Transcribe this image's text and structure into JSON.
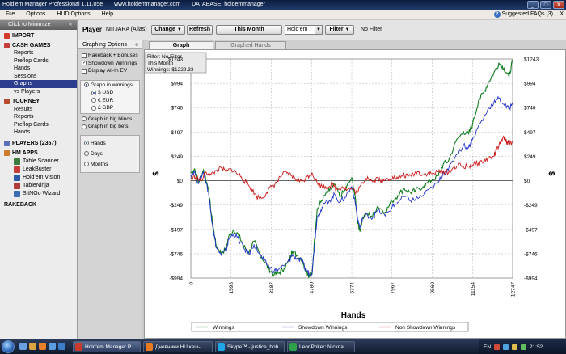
{
  "window": {
    "title": "Hold'em Manager Professional 1.11.05e",
    "site": "www.holdemmanager.com",
    "database": "DATABASE: holdemmanager",
    "controls": [
      "_",
      "□",
      "X"
    ]
  },
  "menu": {
    "items": [
      "File",
      "Options",
      "HUD Options",
      "Help"
    ],
    "faq": "Suggested FAQs (3)",
    "close": "X"
  },
  "nav": {
    "minimize": "Click to Minimize",
    "import": "IMPORT",
    "cash_games": "CASH GAMES",
    "cash_items": [
      "Reports",
      "Preflop Cards",
      "Hands",
      "Sessions",
      "Graphs",
      "vs Players"
    ],
    "tourney": "TOURNEY",
    "tourney_items": [
      "Results",
      "Reports",
      "Preflop Cards",
      "Hands"
    ],
    "players": "PLAYERS (2357)",
    "hm_apps": "HM APPS",
    "apps": [
      "Table Scanner",
      "LeakBuster",
      "Hold'em Vision",
      "TableNinja",
      "SitNGo Wizard"
    ],
    "rakeback": "RAKEBACK"
  },
  "toolbar": {
    "player_label": "Player",
    "player_name": "NITJARA (Alias)",
    "change": "Change",
    "refresh": "Refresh",
    "period": "This Month",
    "game": "Hold'em",
    "filter": "Filter",
    "filter_status": "No Filter"
  },
  "options": {
    "header": "Graphing Options",
    "checks": [
      {
        "label": "Rakeback + Bonuses",
        "checked": false
      },
      {
        "label": "Showdown Winnings",
        "checked": true
      },
      {
        "label": "Display All-In EV",
        "checked": false
      }
    ],
    "mode_winnings": "Graph in winnings",
    "currencies": [
      {
        "label": "$ USD",
        "selected": true
      },
      {
        "label": "€ EUR",
        "selected": false
      },
      {
        "label": "£ GBP",
        "selected": false
      }
    ],
    "mode_bb": "Graph in big blinds",
    "mode_bets": "Graph in big bets",
    "xaxis": [
      {
        "label": "Hands",
        "selected": true
      },
      {
        "label": "Days",
        "selected": false
      },
      {
        "label": "Months",
        "selected": false
      }
    ]
  },
  "tabs": {
    "graph": "Graph",
    "graphed_hands": "Graphed Hands"
  },
  "chart_data": {
    "type": "line",
    "info_lines": [
      "Filter: No Filter",
      "This Month",
      "Winnings: $1229.33"
    ],
    "xlabel": "Hands",
    "ylabel": "$",
    "xlim": [
      0,
      12747
    ],
    "ylim": [
      -994,
      1243
    ],
    "x_ticks": [
      "0",
      "1593",
      "3187",
      "4780",
      "6374",
      "7967",
      "9560",
      "11154",
      "12747"
    ],
    "y_ticks": [
      "-$994",
      "-$746",
      "-$497",
      "-$249",
      "$0",
      "$249",
      "$497",
      "$746",
      "$994",
      "$1243"
    ],
    "x_tick_values": [
      0,
      1593,
      3187,
      4780,
      6374,
      7967,
      9560,
      11154,
      12747
    ],
    "y_tick_values": [
      -994,
      -746,
      -497,
      -249,
      0,
      249,
      497,
      746,
      994,
      1243
    ],
    "grid": true,
    "legend_position": "bottom",
    "series": [
      {
        "name": "Winnings",
        "color": "#0a7a1a",
        "points": [
          [
            0,
            80
          ],
          [
            150,
            120
          ],
          [
            300,
            -20
          ],
          [
            500,
            110
          ],
          [
            700,
            -90
          ],
          [
            800,
            -320
          ],
          [
            900,
            -500
          ],
          [
            1000,
            -660
          ],
          [
            1200,
            -740
          ],
          [
            1400,
            -690
          ],
          [
            1500,
            -570
          ],
          [
            1700,
            -500
          ],
          [
            1900,
            -560
          ],
          [
            2100,
            -670
          ],
          [
            2300,
            -740
          ],
          [
            2500,
            -620
          ],
          [
            2700,
            -730
          ],
          [
            2900,
            -820
          ],
          [
            3100,
            -900
          ],
          [
            3300,
            -960
          ],
          [
            3500,
            -940
          ],
          [
            3700,
            -890
          ],
          [
            3900,
            -820
          ],
          [
            4000,
            -710
          ],
          [
            4200,
            -760
          ],
          [
            4400,
            -800
          ],
          [
            4500,
            -880
          ],
          [
            4600,
            -930
          ],
          [
            4700,
            -980
          ],
          [
            4800,
            -960
          ],
          [
            4900,
            -600
          ],
          [
            5000,
            -300
          ],
          [
            5150,
            -220
          ],
          [
            5300,
            -150
          ],
          [
            5500,
            -100
          ],
          [
            5700,
            -40
          ],
          [
            5900,
            -160
          ],
          [
            6100,
            -100
          ],
          [
            6374,
            30
          ],
          [
            6500,
            -150
          ],
          [
            6600,
            -400
          ],
          [
            6700,
            -520
          ],
          [
            6800,
            -380
          ],
          [
            7000,
            -340
          ],
          [
            7200,
            -360
          ],
          [
            7400,
            -260
          ],
          [
            7700,
            -320
          ],
          [
            7967,
            -210
          ],
          [
            8200,
            -150
          ],
          [
            8450,
            -80
          ],
          [
            8700,
            -120
          ],
          [
            8900,
            -100
          ],
          [
            9200,
            -60
          ],
          [
            9560,
            10
          ],
          [
            9800,
            50
          ],
          [
            10000,
            170
          ],
          [
            10200,
            200
          ],
          [
            10500,
            400
          ],
          [
            10800,
            500
          ],
          [
            11000,
            480
          ],
          [
            11154,
            570
          ],
          [
            11400,
            820
          ],
          [
            11600,
            900
          ],
          [
            11800,
            1010
          ],
          [
            12000,
            1100
          ],
          [
            12200,
            1200
          ],
          [
            12400,
            1150
          ],
          [
            12600,
            1060
          ],
          [
            12747,
            1229
          ]
        ]
      },
      {
        "name": "Showdown Winnings",
        "color": "#2233cc",
        "points": [
          [
            0,
            60
          ],
          [
            150,
            90
          ],
          [
            300,
            -30
          ],
          [
            500,
            90
          ],
          [
            700,
            -120
          ],
          [
            800,
            -340
          ],
          [
            900,
            -520
          ],
          [
            1000,
            -680
          ],
          [
            1200,
            -760
          ],
          [
            1400,
            -710
          ],
          [
            1500,
            -600
          ],
          [
            1700,
            -540
          ],
          [
            1900,
            -600
          ],
          [
            2100,
            -690
          ],
          [
            2300,
            -750
          ],
          [
            2500,
            -650
          ],
          [
            2700,
            -740
          ],
          [
            2900,
            -820
          ],
          [
            3100,
            -880
          ],
          [
            3300,
            -920
          ],
          [
            3500,
            -900
          ],
          [
            3700,
            -870
          ],
          [
            3900,
            -820
          ],
          [
            4000,
            -760
          ],
          [
            4200,
            -790
          ],
          [
            4400,
            -820
          ],
          [
            4500,
            -880
          ],
          [
            4600,
            -920
          ],
          [
            4700,
            -950
          ],
          [
            4800,
            -940
          ],
          [
            4900,
            -650
          ],
          [
            5000,
            -380
          ],
          [
            5150,
            -300
          ],
          [
            5300,
            -230
          ],
          [
            5500,
            -200
          ],
          [
            5700,
            -140
          ],
          [
            5900,
            -220
          ],
          [
            6100,
            -170
          ],
          [
            6374,
            -60
          ],
          [
            6500,
            -200
          ],
          [
            6600,
            -380
          ],
          [
            6700,
            -480
          ],
          [
            6800,
            -380
          ],
          [
            7000,
            -350
          ],
          [
            7200,
            -380
          ],
          [
            7400,
            -300
          ],
          [
            7700,
            -360
          ],
          [
            7967,
            -270
          ],
          [
            8200,
            -220
          ],
          [
            8450,
            -160
          ],
          [
            8700,
            -200
          ],
          [
            8900,
            -190
          ],
          [
            9200,
            -150
          ],
          [
            9560,
            -70
          ],
          [
            9800,
            -20
          ],
          [
            10000,
            80
          ],
          [
            10200,
            110
          ],
          [
            10500,
            260
          ],
          [
            10800,
            360
          ],
          [
            11000,
            340
          ],
          [
            11154,
            420
          ],
          [
            11400,
            560
          ],
          [
            11600,
            640
          ],
          [
            11800,
            740
          ],
          [
            12000,
            800
          ],
          [
            12200,
            840
          ],
          [
            12400,
            780
          ],
          [
            12600,
            730
          ],
          [
            12747,
            800
          ]
        ]
      },
      {
        "name": "Non Showdown Winnings",
        "color": "#cc1a1a",
        "points": [
          [
            0,
            20
          ],
          [
            200,
            40
          ],
          [
            400,
            -10
          ],
          [
            600,
            90
          ],
          [
            800,
            60
          ],
          [
            1000,
            100
          ],
          [
            1200,
            130
          ],
          [
            1400,
            90
          ],
          [
            1600,
            120
          ],
          [
            1800,
            80
          ],
          [
            2000,
            40
          ],
          [
            2200,
            -20
          ],
          [
            2400,
            -80
          ],
          [
            2600,
            -160
          ],
          [
            2800,
            -180
          ],
          [
            3000,
            -120
          ],
          [
            3200,
            -60
          ],
          [
            3400,
            -20
          ],
          [
            3600,
            60
          ],
          [
            3800,
            80
          ],
          [
            4000,
            50
          ],
          [
            4200,
            10
          ],
          [
            4400,
            -10
          ],
          [
            4600,
            40
          ],
          [
            4800,
            80
          ],
          [
            5000,
            -20
          ],
          [
            5200,
            -60
          ],
          [
            5400,
            -60
          ],
          [
            5600,
            -40
          ],
          [
            5800,
            -90
          ],
          [
            6000,
            -60
          ],
          [
            6200,
            -90
          ],
          [
            6374,
            -80
          ],
          [
            6600,
            -120
          ],
          [
            6800,
            -20
          ],
          [
            7000,
            40
          ],
          [
            7200,
            -10
          ],
          [
            7400,
            30
          ],
          [
            7600,
            -10
          ],
          [
            7800,
            20
          ],
          [
            8000,
            40
          ],
          [
            8200,
            20
          ],
          [
            8400,
            60
          ],
          [
            8600,
            40
          ],
          [
            8800,
            70
          ],
          [
            9000,
            90
          ],
          [
            9200,
            60
          ],
          [
            9400,
            80
          ],
          [
            9560,
            70
          ],
          [
            9800,
            90
          ],
          [
            10000,
            100
          ],
          [
            10200,
            80
          ],
          [
            10400,
            130
          ],
          [
            10600,
            160
          ],
          [
            10800,
            140
          ],
          [
            11000,
            150
          ],
          [
            11154,
            160
          ],
          [
            11400,
            180
          ],
          [
            11600,
            200
          ],
          [
            11800,
            230
          ],
          [
            12000,
            250
          ],
          [
            12100,
            310
          ],
          [
            12250,
            380
          ],
          [
            12400,
            440
          ],
          [
            12500,
            400
          ],
          [
            12600,
            380
          ],
          [
            12747,
            400
          ]
        ]
      }
    ]
  },
  "taskbar": {
    "tasks": [
      "Hold'em Manager P...",
      "Дневники HU кеш-...",
      "Skype™ - justice_bob",
      "LeonPoker: Nickna..."
    ],
    "lang": "EN",
    "clock": "21:52"
  }
}
